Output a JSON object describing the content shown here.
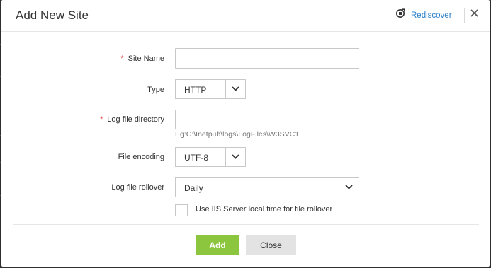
{
  "dialog": {
    "title": "Add New Site",
    "rediscover_label": "Rediscover"
  },
  "form": {
    "site_name": {
      "label": "Site Name",
      "required": true,
      "value": ""
    },
    "type": {
      "label": "Type",
      "value": "HTTP"
    },
    "log_dir": {
      "label": "Log file directory",
      "required": true,
      "value": "",
      "hint": "Eg:C:\\Inetpub\\logs\\LogFiles\\W3SVC1"
    },
    "encoding": {
      "label": "File encoding",
      "value": "UTF-8"
    },
    "rollover": {
      "label": "Log file rollover",
      "value": "Daily"
    },
    "iis_local_time": {
      "label": "Use IIS Server local time for file rollover",
      "checked": false
    }
  },
  "buttons": {
    "add": "Add",
    "close": "Close"
  },
  "colors": {
    "accent_green": "#8cc63f",
    "link_blue": "#2a7fc8",
    "required_red": "#e23d3d"
  },
  "icons": [
    "rediscover-icon",
    "close-icon",
    "chevron-down-icon"
  ]
}
